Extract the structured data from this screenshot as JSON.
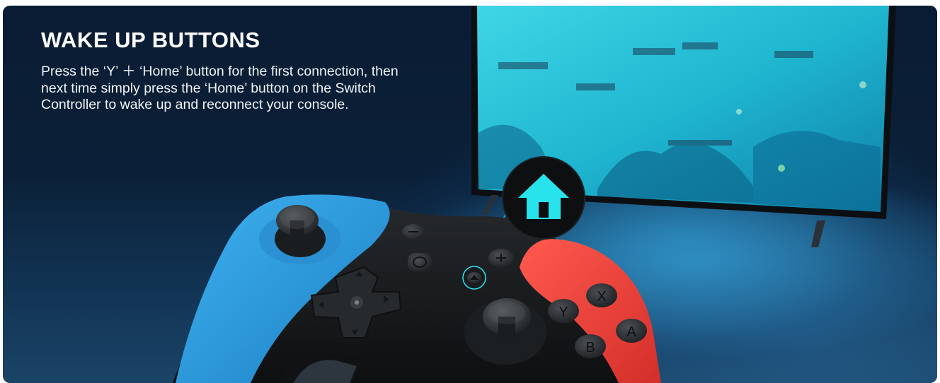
{
  "banner": {
    "title": "WAKE UP BUTTONS",
    "description": "Press the ‘Y’ ＋ ‘Home’ button for the first connection, then next time simply press the ‘Home’ button on the Switch Controller to wake up and reconnect your console."
  },
  "controller": {
    "face_buttons": {
      "top": "X",
      "left": "Y",
      "right": "A",
      "bottom": "B"
    },
    "body_color": "#141618",
    "left_grip_color": "#2b9fe3",
    "right_grip_color": "#f0443e"
  },
  "callout": {
    "icon": "home-icon",
    "accent_color": "#29e3ec"
  },
  "tv": {
    "screen_tint": "#1fc6d8"
  }
}
